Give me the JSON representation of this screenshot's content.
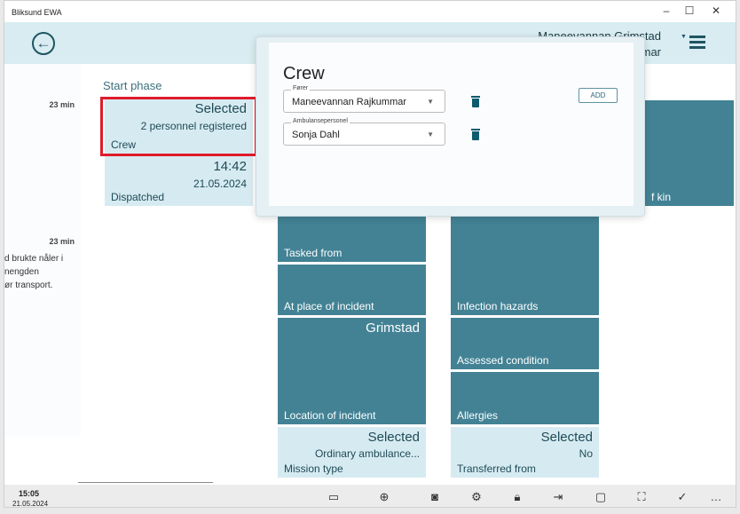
{
  "window": {
    "title": "Bliksund EWA",
    "minimize": "–",
    "maximize": "☐",
    "close": "✕"
  },
  "header": {
    "user_line1": "Maneevannan Grimstad",
    "user_line2": "mar"
  },
  "left": {
    "time1": "23 min",
    "time2": "23 min",
    "note_lines": [
      "d brukte nåler i",
      "nengden",
      "ør transport."
    ]
  },
  "phase_label": "Start phase",
  "tiles": {
    "crew": {
      "value": "Selected",
      "sub": "2 personnel registered",
      "label": "Crew"
    },
    "dispatched": {
      "value": "14:42",
      "sub": "21.05.2024",
      "label": "Dispatched"
    },
    "tasked_from": {
      "label": "Tasked from"
    },
    "at_place": {
      "label": "At place of incident"
    },
    "location": {
      "value": "Grimstad",
      "label": "Location of incident"
    },
    "mission_type": {
      "value": "Selected",
      "sub": "Ordinary ambulance...",
      "label": "Mission type"
    },
    "infection": {
      "label": "Infection hazards"
    },
    "assessed": {
      "label": "Assessed condition"
    },
    "allergies": {
      "label": "Allergies"
    },
    "transferred": {
      "value": "Selected",
      "sub": "No",
      "label": "Transferred from"
    },
    "next_of_kin": {
      "label": "f kin"
    }
  },
  "dialog": {
    "title": "Crew",
    "add_label": "ADD",
    "fields": [
      {
        "label": "Fører",
        "value": "Maneevannan Rajkummar"
      },
      {
        "label": "Ambulansepersonel",
        "value": "Sonja Dahl"
      }
    ]
  },
  "bottom": {
    "time": "15:05",
    "date": "21.05.2024",
    "icons": [
      "video-icon",
      "globe-icon",
      "contact-icon",
      "gear-icon",
      "lock-icon",
      "transfer-icon",
      "chat-icon",
      "scan-icon",
      "check-icon",
      "more-icon"
    ]
  },
  "colors": {
    "tile_dark": "#428294",
    "tile_light": "#d6ebf1",
    "highlight": "#e01b2c",
    "header": "#d8ecf1"
  }
}
